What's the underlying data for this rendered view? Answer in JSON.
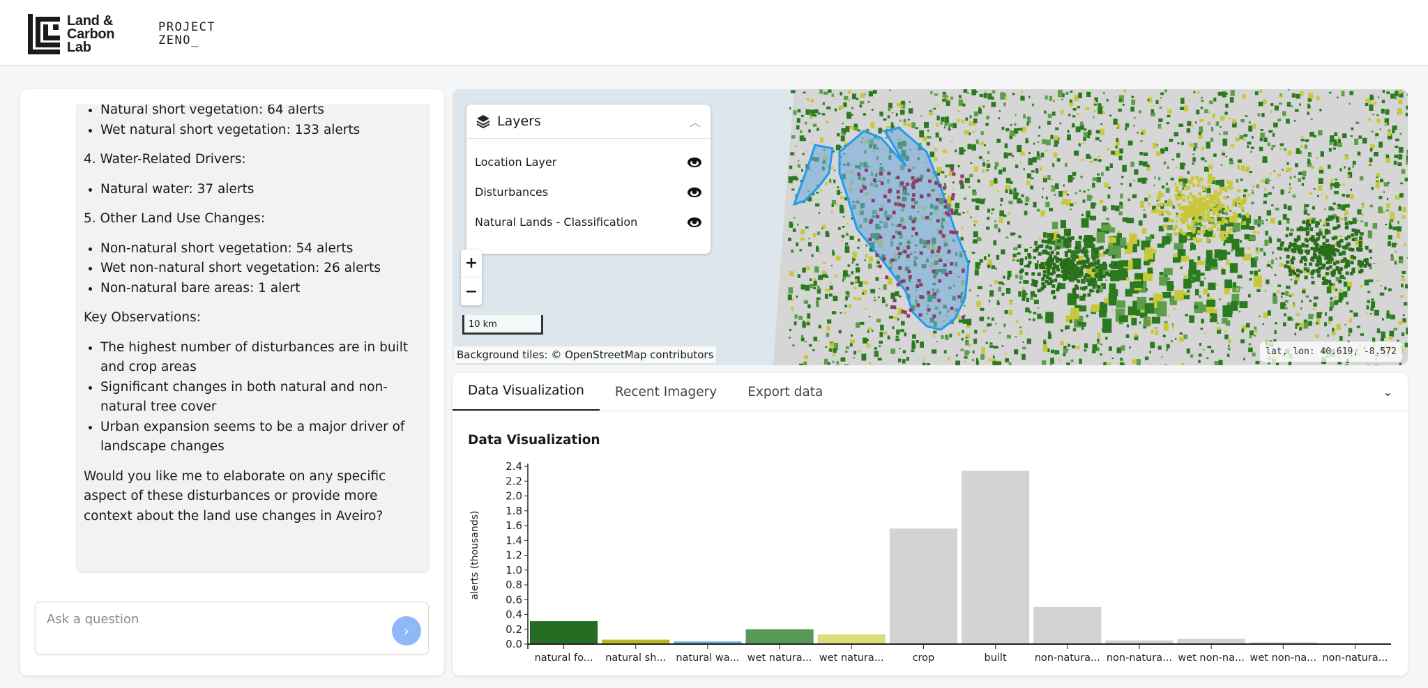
{
  "header": {
    "logo_text": [
      "Land &",
      "Carbon",
      "Lab"
    ],
    "project": [
      "PROJECT",
      "ZENO_"
    ]
  },
  "chat": {
    "blocks": [
      {
        "type": "ul",
        "items": [
          "Natural short vegetation: 64 alerts",
          "Wet natural short vegetation: 133 alerts"
        ]
      },
      {
        "type": "p",
        "text": "4. Water-Related Drivers:"
      },
      {
        "type": "ul",
        "items": [
          "Natural water: 37 alerts"
        ]
      },
      {
        "type": "p",
        "text": "5. Other Land Use Changes:"
      },
      {
        "type": "ul",
        "items": [
          "Non-natural short vegetation: 54 alerts",
          "Wet non-natural short vegetation: 26 alerts",
          "Non-natural bare areas: 1 alert"
        ]
      },
      {
        "type": "p",
        "text": "Key Observations:"
      },
      {
        "type": "ul",
        "items": [
          "The highest number of disturbances are in built and crop areas",
          "Significant changes in both natural and non-natural tree cover",
          "Urban expansion seems to be a major driver of landscape changes"
        ]
      },
      {
        "type": "p",
        "text": "Would you like me to elaborate on any specific aspect of these disturbances or provide more context about the land use changes in Aveiro?"
      }
    ],
    "input_placeholder": "Ask a question",
    "send_icon": "chevron-right-icon"
  },
  "map": {
    "layers_title": "Layers",
    "layers": [
      "Location Layer",
      "Disturbances",
      "Natural Lands - Classification"
    ],
    "zoom_in": "+",
    "zoom_out": "−",
    "scale": "10 km",
    "attribution": "Background tiles: © OpenStreetMap contributors",
    "coords": "lat, lon: 40.619, -8.572"
  },
  "panel": {
    "tabs": [
      "Data Visualization",
      "Recent Imagery",
      "Export data"
    ],
    "active_tab": 0,
    "title": "Data Visualization"
  },
  "chart_data": {
    "type": "bar",
    "title": "",
    "ylabel": "alerts (thousands)",
    "ylim": [
      0,
      2.4
    ],
    "yticks": [
      "0.0",
      "0.2",
      "0.4",
      "0.6",
      "0.8",
      "1.0",
      "1.2",
      "1.4",
      "1.6",
      "1.8",
      "2.0",
      "2.2",
      "2.4"
    ],
    "categories": [
      "natural fo...",
      "natural sh...",
      "natural wa...",
      "wet natura...",
      "wet natura...",
      "crop",
      "built",
      "non-natura...",
      "non-natura...",
      "wet non-na...",
      "wet non-na...",
      "non-natura..."
    ],
    "values": [
      0.31,
      0.06,
      0.035,
      0.2,
      0.13,
      1.56,
      2.34,
      0.5,
      0.05,
      0.07,
      0.025,
      0.001
    ],
    "colors": [
      "#246d23",
      "#b8b81c",
      "#6aaed6",
      "#569957",
      "#dcdc7a",
      "#d3d3d3",
      "#d3d3d3",
      "#d3d3d3",
      "#d3d3d3",
      "#d3d3d3",
      "#d3d3d3",
      "#d3d3d3"
    ]
  }
}
